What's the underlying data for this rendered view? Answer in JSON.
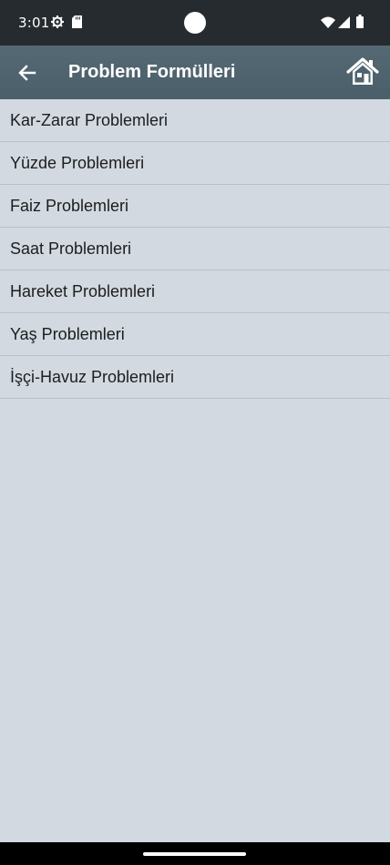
{
  "status_bar": {
    "time": "3:01",
    "icons": [
      "gear-icon",
      "sd-card-icon",
      "wifi-icon",
      "signal-icon",
      "battery-icon"
    ]
  },
  "app_bar": {
    "title": "Problem Formülleri",
    "back_icon": "arrow-left-icon",
    "home_icon": "home-icon",
    "background_color": "#4f636e"
  },
  "list": {
    "items": [
      {
        "label": "Kar-Zarar Problemleri"
      },
      {
        "label": "Yüzde Problemleri"
      },
      {
        "label": "Faiz Problemleri"
      },
      {
        "label": "Saat Problemleri"
      },
      {
        "label": "Hareket Problemleri"
      },
      {
        "label": "Yaş Problemleri"
      },
      {
        "label": "İşçi-Havuz Problemleri"
      }
    ],
    "background_color": "#d2d9e0"
  }
}
